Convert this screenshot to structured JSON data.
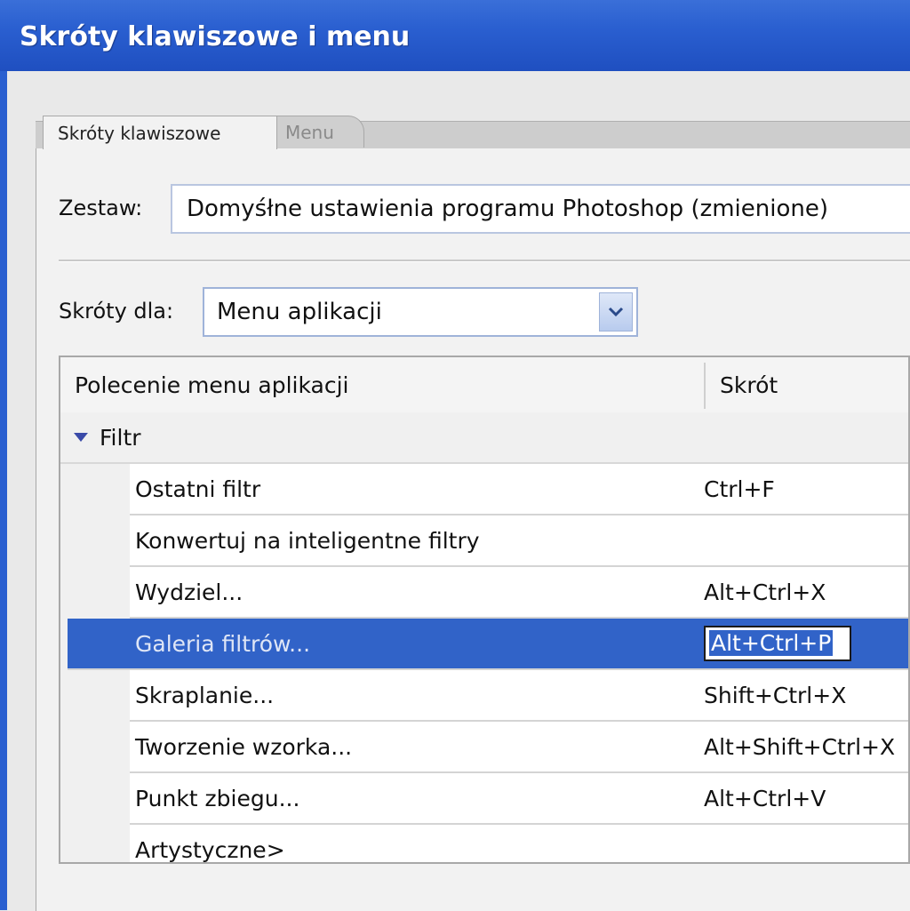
{
  "window": {
    "title": "Skróty klawiszowe i menu"
  },
  "tabs": [
    {
      "label": "Skróty klawiszowe",
      "active": true
    },
    {
      "label": "Menu",
      "active": false
    }
  ],
  "set": {
    "label": "Zestaw:",
    "value": "Domyśłne ustawienia programu Photoshop (zmienione)"
  },
  "shortcuts_for": {
    "label": "Skróty dla:",
    "value": "Menu aplikacji"
  },
  "table": {
    "headers": {
      "command": "Polecenie menu aplikacji",
      "shortcut": "Skrót"
    },
    "group": {
      "label": "Filtr",
      "expanded": true
    },
    "rows": [
      {
        "command": "Ostatni filtr",
        "shortcut": "Ctrl+F"
      },
      {
        "command": "Konwertuj na inteligentne filtry",
        "shortcut": ""
      },
      {
        "command": "Wydziel...",
        "shortcut": "Alt+Ctrl+X"
      },
      {
        "command": "Galeria filtrów...",
        "shortcut": "Alt+Ctrl+P",
        "selected": true
      },
      {
        "command": "Skraplanie...",
        "shortcut": "Shift+Ctrl+X"
      },
      {
        "command": "Tworzenie wzorka...",
        "shortcut": "Alt+Shift+Ctrl+X"
      },
      {
        "command": "Punkt zbiegu...",
        "shortcut": "Alt+Ctrl+V"
      },
      {
        "command": "Artystyczne>",
        "shortcut": ""
      }
    ]
  },
  "colors": {
    "titlebar": "#2a5fd0",
    "selection": "#3163c8"
  }
}
